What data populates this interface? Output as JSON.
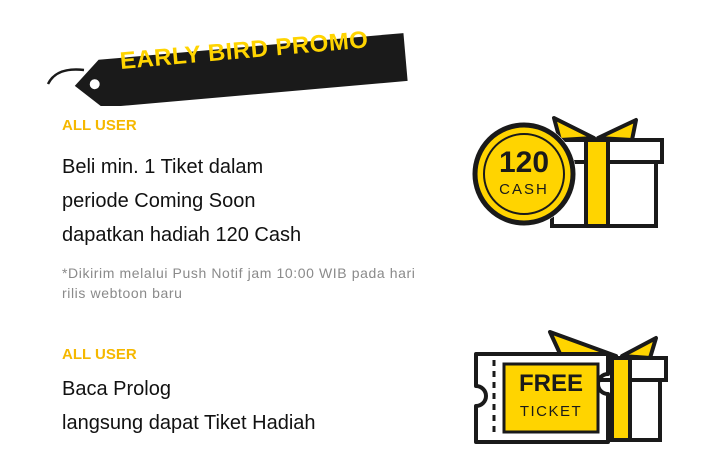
{
  "promo": {
    "title": "EARLY BIRD PROMO"
  },
  "offers": [
    {
      "audience": "ALL USER",
      "lines": [
        "Beli min. 1 Tiket dalam",
        "periode Coming Soon",
        "dapatkan hadiah 120 Cash"
      ],
      "note_lines": [
        "*Dikirim melalui Push Notif jam 10:00 WIB pada hari",
        " rilis webtoon baru"
      ],
      "badge": {
        "amount": "120",
        "unit": "CASH"
      }
    },
    {
      "audience": "ALL USER",
      "lines": [
        "Baca Prolog",
        "langsung dapat Tiket Hadiah"
      ],
      "badge": {
        "line1": "FREE",
        "line2": "TICKET"
      }
    }
  ],
  "colors": {
    "accent": "#ffd400",
    "label": "#f5b800",
    "dark": "#1a1a1a"
  }
}
